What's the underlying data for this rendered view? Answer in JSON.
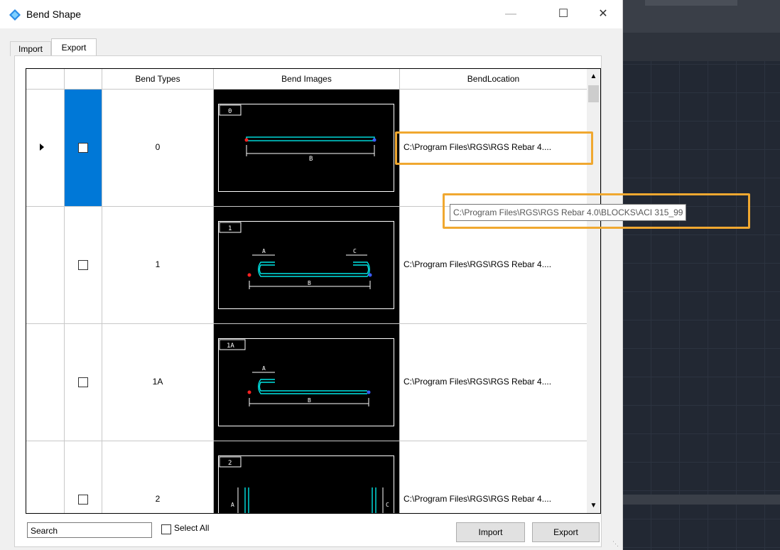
{
  "window": {
    "title": "Bend Shape",
    "minimize_glyph": "—",
    "maximize_glyph": "☐",
    "close_glyph": "✕"
  },
  "tabs": [
    {
      "label": "Import",
      "active": false
    },
    {
      "label": "Export",
      "active": true
    }
  ],
  "grid": {
    "columns": [
      "",
      "",
      "Bend Types",
      "Bend Images",
      "BendLocation"
    ],
    "rows": [
      {
        "type": "0",
        "image_label": "0",
        "location": "C:\\Program Files\\RGS\\RGS Rebar 4....",
        "selected": true,
        "checked": false
      },
      {
        "type": "1",
        "image_label": "1",
        "location": "C:\\Program Files\\RGS\\RGS Rebar 4....",
        "selected": false,
        "checked": false
      },
      {
        "type": "1A",
        "image_label": "1A",
        "location": "C:\\Program Files\\RGS\\RGS Rebar 4....",
        "selected": false,
        "checked": false
      },
      {
        "type": "2",
        "image_label": "2",
        "location": "C:\\Program Files\\RGS\\RGS Rebar 4....",
        "selected": false,
        "checked": false
      }
    ],
    "dim_labels": {
      "a": "A",
      "b": "B",
      "c": "C"
    }
  },
  "tooltip": {
    "text": "C:\\Program Files\\RGS\\RGS Rebar 4.0\\BLOCKS\\ACI 315_99"
  },
  "footer": {
    "search_value": "Search",
    "select_all_label": "Select All",
    "import_label": "Import",
    "export_label": "Export"
  },
  "colors": {
    "accent": "#0078d7",
    "highlight": "#f0a830",
    "bar": "#00e5e5",
    "dim": "#ffffff",
    "start_point": "#ff2020",
    "end_point": "#3a5cff"
  },
  "icons": {
    "app": "diamond-app-icon",
    "row_indicator": "triangle-right-icon",
    "scroll_up": "chevron-up-icon",
    "scroll_down": "chevron-down-icon"
  }
}
